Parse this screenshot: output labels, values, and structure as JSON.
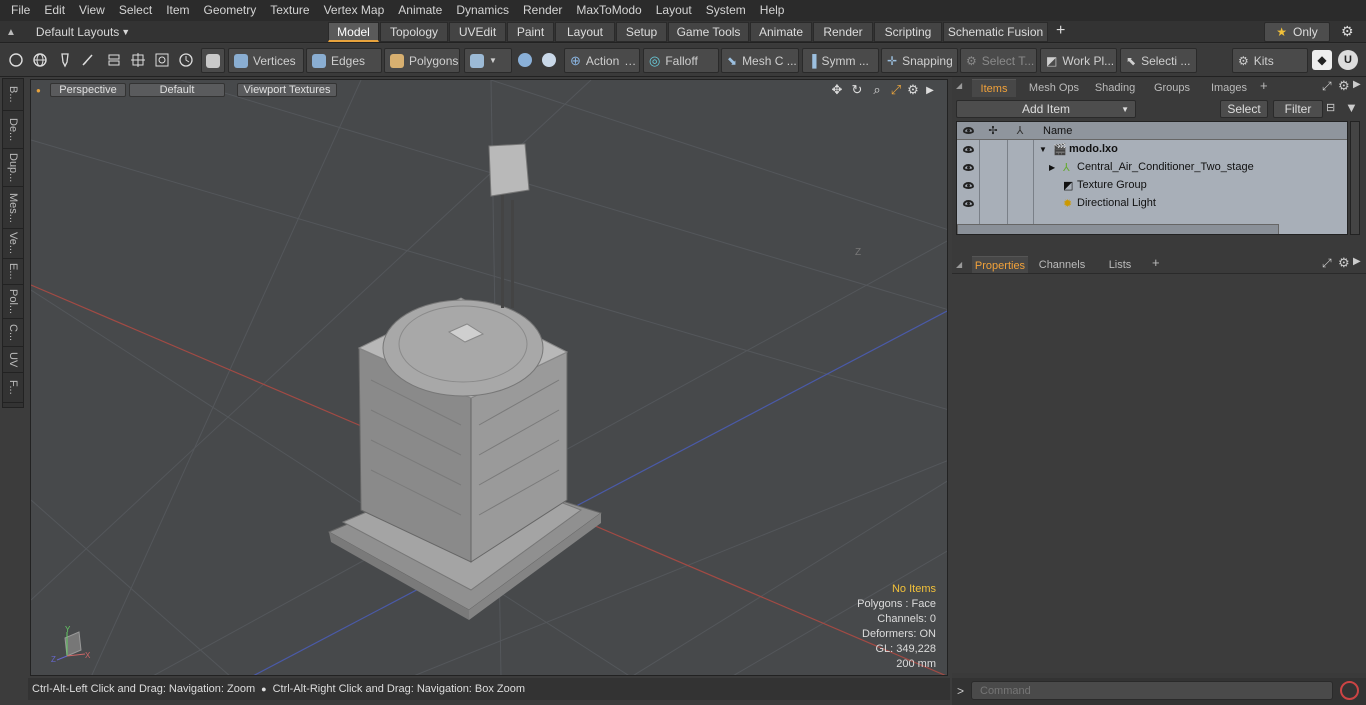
{
  "menu": [
    "File",
    "Edit",
    "View",
    "Select",
    "Item",
    "Geometry",
    "Texture",
    "Vertex Map",
    "Animate",
    "Dynamics",
    "Render",
    "MaxToModo",
    "Layout",
    "System",
    "Help"
  ],
  "layouts_label": "Default Layouts",
  "mode_tabs": [
    {
      "label": "Model",
      "active": true
    },
    {
      "label": "Topology"
    },
    {
      "label": "UVEdit"
    },
    {
      "label": "Paint"
    },
    {
      "label": "Layout"
    },
    {
      "label": "Setup"
    },
    {
      "label": "Game Tools"
    },
    {
      "label": "Animate"
    },
    {
      "label": "Render"
    },
    {
      "label": "Scripting"
    },
    {
      "label": "Schematic Fusion"
    }
  ],
  "only_label": "Only",
  "toolbar": {
    "vertices": "Vertices",
    "edges": "Edges",
    "polygons": "Polygons",
    "action": "Action",
    "falloff": "Falloff",
    "mesh_c": "Mesh C ...",
    "symm": "Symm ...",
    "snapping": "Snapping",
    "select_t": "Select T...",
    "work_pl": "Work Pl...",
    "selecti": "Selecti ...",
    "kits": "Kits"
  },
  "left_tabs": [
    "B...",
    "De...",
    "Dup...",
    "Mes...",
    "Ve...",
    "E...",
    "Pol...",
    "C...",
    "UV",
    "F..."
  ],
  "viewport": {
    "perspective": "Perspective",
    "default": "Default",
    "textures": "Viewport Textures",
    "axis_z": "Z",
    "stats": {
      "no_items": "No Items",
      "polygons": "Polygons : Face",
      "channels": "Channels: 0",
      "deformers": "Deformers: ON",
      "gl": "GL: 349,228",
      "size": "200 mm"
    }
  },
  "status": {
    "left": "Ctrl-Alt-Left Click and Drag: Navigation: Zoom",
    "right": "Ctrl-Alt-Right Click and Drag: Navigation: Box Zoom"
  },
  "items_tabs": [
    "Items",
    "Mesh Ops",
    "Shading",
    "Groups",
    "Images"
  ],
  "add_item": "Add Item",
  "select_btn": "Select",
  "filter_btn": "Filter",
  "tree": {
    "name_header": "Name",
    "rows": [
      {
        "label": "modo.lxo",
        "bold": true
      },
      {
        "label": "Central_Air_Conditioner_Two_stage"
      },
      {
        "label": "Texture Group"
      },
      {
        "label": "Directional Light"
      }
    ]
  },
  "prop_tabs": [
    "Properties",
    "Channels",
    "Lists"
  ],
  "command_placeholder": "Command",
  "colors": {
    "accent": "#f2a23a",
    "tree_bg": "#a8afb8",
    "viewport_bg": "#47494b"
  }
}
